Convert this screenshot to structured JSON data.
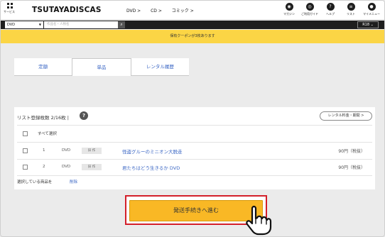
{
  "header": {
    "services_label": "サービス",
    "logo": "TSUTAYADISCAS",
    "nav": [
      "DVD >",
      "CD >",
      "コミック >"
    ],
    "icons": [
      {
        "icon": "magazine-icon",
        "glyph": "◉",
        "label": "マガジン"
      },
      {
        "icon": "guide-icon",
        "glyph": "◎",
        "label": "ご利用ガイド"
      },
      {
        "icon": "help-icon",
        "glyph": "?",
        "label": "ヘルプ"
      },
      {
        "icon": "list-icon",
        "glyph": "≡",
        "label": "リスト"
      },
      {
        "icon": "mypage-icon",
        "glyph": "●",
        "label": "マイメニュー"
      }
    ]
  },
  "search": {
    "category": "DVD",
    "placeholder": "作品名・人物名",
    "button_glyph": "⌕",
    "rating": "R18 ⌄"
  },
  "coupon": {
    "text": "保有クーポンが3枚あります"
  },
  "tabs": [
    {
      "label": "定額",
      "active": false
    },
    {
      "label": "単品",
      "active": true
    },
    {
      "label": "レンタル履歴",
      "active": false
    }
  ],
  "list": {
    "count_text": "リスト登録枚数  2/16枚 |",
    "help_glyph": "?",
    "fee_button": "レンタル料金・期間 >",
    "select_all": "すべて選択",
    "items": [
      {
        "num": "1",
        "format": "DVD",
        "badge": "旧 作",
        "title": "怪盗グルーのミニオン大脱走",
        "price": "90円（税抜）"
      },
      {
        "num": "2",
        "format": "DVD",
        "badge": "旧 作",
        "title": "君たちはどう生きるか DVD",
        "price": "90円（税抜）"
      }
    ],
    "selected_label": "選択している商品を",
    "delete_label": "削除"
  },
  "cta": {
    "label": "発送手続きへ進む"
  },
  "colors": {
    "accent": "#f9b825",
    "highlight": "#d31f2a",
    "link": "#3a66c4",
    "coupon": "#fbd545"
  }
}
